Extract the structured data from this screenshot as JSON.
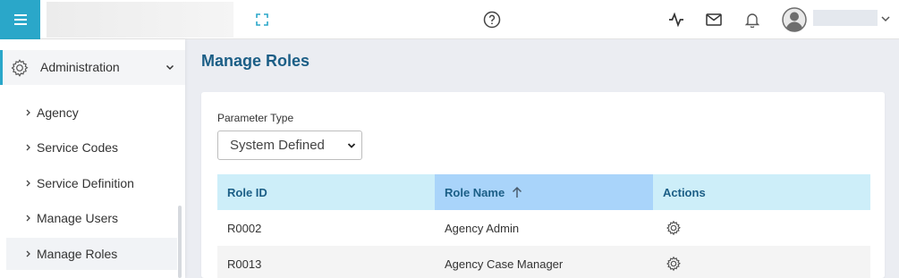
{
  "header": {
    "menu_icon": "hamburger-icon",
    "icons": [
      "expand-icon",
      "help-icon",
      "activity-icon",
      "mail-icon",
      "bell-icon",
      "user-avatar-icon",
      "chevron-down-icon"
    ]
  },
  "sidebar": {
    "section": {
      "label": "Administration",
      "icon": "gear-icon",
      "expanded": true
    },
    "items": [
      {
        "label": "Agency",
        "active": false
      },
      {
        "label": "Service Codes",
        "active": false
      },
      {
        "label": "Service Definition",
        "active": false
      },
      {
        "label": "Manage Users",
        "active": false
      },
      {
        "label": "Manage Roles",
        "active": true
      }
    ]
  },
  "main": {
    "title": "Manage Roles",
    "filter": {
      "label": "Parameter Type",
      "selected": "System Defined"
    },
    "table": {
      "columns": [
        {
          "label": "Role ID",
          "sorted": false
        },
        {
          "label": "Role Name",
          "sorted": true,
          "sort_direction": "ascending"
        },
        {
          "label": "Actions",
          "sorted": false
        }
      ],
      "rows": [
        {
          "role_id": "R0002",
          "role_name": "Agency Admin",
          "action_icon": "gear-icon"
        },
        {
          "role_id": "R0013",
          "role_name": "Agency Case Manager",
          "action_icon": "gear-icon"
        }
      ]
    }
  },
  "colors": {
    "accent": "#2aa7c9",
    "title": "#1b5e86",
    "table_header": "#cdeef9",
    "sorted_header": "#a9d4fa"
  }
}
